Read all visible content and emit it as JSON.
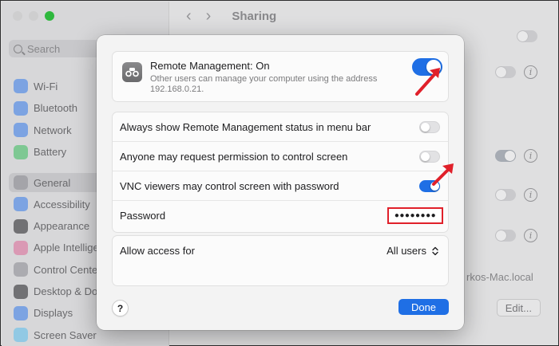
{
  "window": {
    "title": "Sharing",
    "search_placeholder": "Search",
    "sidebar_items": [
      {
        "label": "Wi-Fi",
        "icon": "wifi-icon",
        "color": "#2f7df6"
      },
      {
        "label": "Bluetooth",
        "icon": "bluetooth-icon",
        "color": "#2f7df6"
      },
      {
        "label": "Network",
        "icon": "network-icon",
        "color": "#2f7df6"
      },
      {
        "label": "Battery",
        "icon": "battery-icon",
        "color": "#34c759"
      },
      {
        "label": "General",
        "icon": "gear-icon",
        "color": "#8e8e93"
      },
      {
        "label": "Accessibility",
        "icon": "accessibility-icon",
        "color": "#2f7df6"
      },
      {
        "label": "Appearance",
        "icon": "appearance-icon",
        "color": "#1c1c1e"
      },
      {
        "label": "Apple Intelligence",
        "icon": "apple-intelligence-icon",
        "color": "#e96a9a"
      },
      {
        "label": "Control Center",
        "icon": "control-center-icon",
        "color": "#8e8e93"
      },
      {
        "label": "Desktop & Dock",
        "icon": "dock-icon",
        "color": "#1c1c1e"
      },
      {
        "label": "Displays",
        "icon": "displays-icon",
        "color": "#2f7df6"
      },
      {
        "label": "Screen Saver",
        "icon": "screen-saver-icon",
        "color": "#5ac8fa"
      }
    ],
    "local_hostname_fragment": "rkos-Mac.local",
    "edit_button": "Edit..."
  },
  "sheet": {
    "remote_management": {
      "title": "Remote Management: On",
      "description": "Other users can manage your computer using the address 192.168.0.21.",
      "enabled": true
    },
    "options": [
      {
        "label": "Always show Remote Management status in menu bar",
        "enabled": false
      },
      {
        "label": "Anyone may request permission to control screen",
        "enabled": false
      },
      {
        "label": "VNC viewers may control screen with password",
        "enabled": true
      }
    ],
    "password": {
      "label": "Password",
      "value": "●●●●●●●●"
    },
    "allow_access": {
      "label": "Allow access for",
      "value": "All users"
    },
    "help_label": "?",
    "done_label": "Done"
  },
  "colors": {
    "accent": "#1f6fe5",
    "highlight": "#e0202a"
  }
}
